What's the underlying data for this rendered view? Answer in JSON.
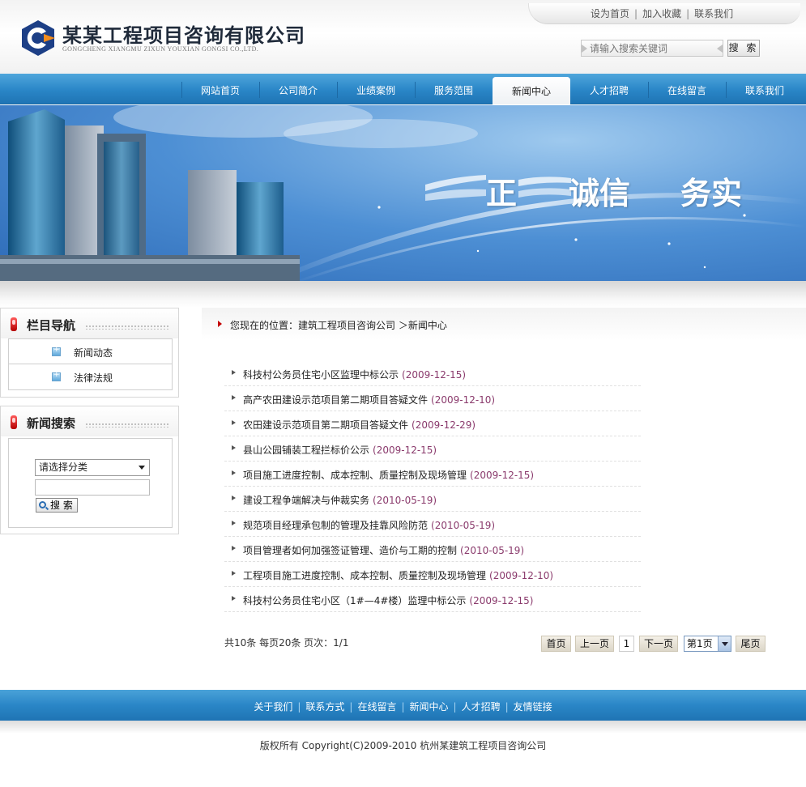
{
  "header": {
    "company_name": "某某工程项目咨询有限公司",
    "company_name_en": "GONGCHENG XIANGMU ZIXUN YOUXIAN GONGSI CO.,LTD.",
    "top_links": [
      "设为首页",
      "加入收藏",
      "联系我们"
    ],
    "search_placeholder": "请输入搜索关键词",
    "search_button": "搜 索"
  },
  "nav": {
    "items": [
      "网站首页",
      "公司简介",
      "业绩案例",
      "服务范围",
      "新闻中心",
      "人才招聘",
      "在线留言",
      "联系我们"
    ],
    "active": "新闻中心"
  },
  "banner": {
    "slogan": [
      "正",
      "诚信",
      "务实"
    ]
  },
  "sidebar": {
    "nav_title": "栏目导航",
    "categories": [
      "新闻动态",
      "法律法规"
    ],
    "search_title": "新闻搜索",
    "category_select": "请选择分类",
    "search_button": "搜 索"
  },
  "breadcrumb": "您现在的位置：建筑工程项目咨询公司 ＞新闻中心",
  "news": [
    {
      "title": "科技村公务员住宅小区监理中标公示",
      "date": "(2009-12-15)"
    },
    {
      "title": "高产农田建设示范项目第二期项目答疑文件",
      "date": "(2009-12-10)"
    },
    {
      "title": "农田建设示范项目第二期项目答疑文件",
      "date": "(2009-12-29)"
    },
    {
      "title": "县山公园铺装工程拦标价公示",
      "date": "(2009-12-15)"
    },
    {
      "title": "项目施工进度控制、成本控制、质量控制及现场管理",
      "date": "(2009-12-15)"
    },
    {
      "title": "建设工程争端解决与仲裁实务",
      "date": "(2010-05-19)"
    },
    {
      "title": "规范项目经理承包制的管理及挂靠风险防范",
      "date": "(2010-05-19)"
    },
    {
      "title": "项目管理者如何加强签证管理、造价与工期的控制",
      "date": "(2010-05-19)"
    },
    {
      "title": "工程项目施工进度控制、成本控制、质量控制及现场管理",
      "date": "(2009-12-10)"
    },
    {
      "title": "科技村公务员住宅小区（1#—4#楼）监理中标公示",
      "date": "(2009-12-15)"
    }
  ],
  "pagination": {
    "info": "共10条  每页20条  页次：1/1",
    "first": "首页",
    "prev": "上一页",
    "current": "1",
    "next": "下一页",
    "page_select": "第1页",
    "last": "尾页"
  },
  "footer": {
    "links": [
      "关于我们",
      "联系方式",
      "在线留言",
      "新闻中心",
      "人才招聘",
      "友情链接"
    ],
    "copyright": "版权所有  Copyright(C)2009-2010 杭州某建筑工程项目咨询公司"
  }
}
